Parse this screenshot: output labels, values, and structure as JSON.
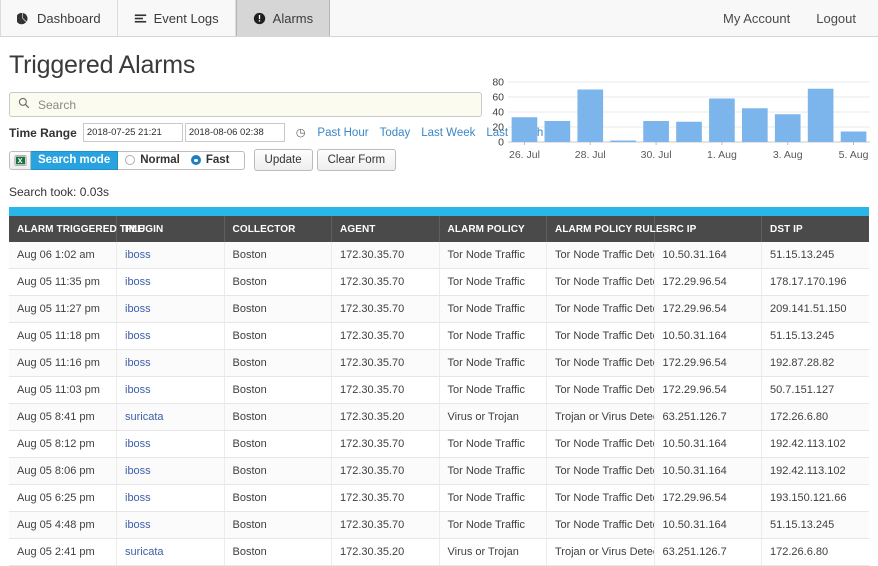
{
  "nav": {
    "tabs": [
      {
        "label": "Dashboard",
        "icon": "pie-chart-icon",
        "active": false
      },
      {
        "label": "Event Logs",
        "icon": "list-icon",
        "active": false
      },
      {
        "label": "Alarms",
        "icon": "alert-icon",
        "active": true
      }
    ],
    "account_label": "My Account",
    "logout_label": "Logout"
  },
  "page": {
    "title": "Triggered Alarms",
    "search_took": "Search took: 0.03s"
  },
  "search": {
    "placeholder": "Search",
    "value": "",
    "icon": "search-icon"
  },
  "time_range": {
    "label": "Time Range",
    "start": "2018-07-25 21:21",
    "end": "2018-08-06 02:38",
    "clock_icon": "clock-icon",
    "quick": [
      "Past Hour",
      "Today",
      "Last Week",
      "Last Month"
    ]
  },
  "controls": {
    "export_icon": "excel-export-icon",
    "search_mode_label": "Search mode",
    "modes": [
      {
        "label": "Normal",
        "selected": false
      },
      {
        "label": "Fast",
        "selected": true
      }
    ],
    "update_label": "Update",
    "clear_label": "Clear Form"
  },
  "colors": {
    "accent": "#29b6e8",
    "bar": "#7cb5ec",
    "link": "#3c5fa8",
    "quick_link": "#3a87c8",
    "header_bg": "#4a4a4a",
    "search_mode_bg": "#29a3e0"
  },
  "chart_data": {
    "type": "bar",
    "title": "",
    "xlabel": "",
    "ylabel": "",
    "ylim": [
      0,
      80
    ],
    "yticks": [
      0,
      20,
      40,
      60,
      80
    ],
    "grid": true,
    "legend": false,
    "categories": [
      "26. Jul",
      "27. Jul",
      "28. Jul",
      "29. Jul",
      "30. Jul",
      "31. Jul",
      "1. Aug",
      "2. Aug",
      "3. Aug",
      "4. Aug",
      "5. Aug"
    ],
    "tick_labels": [
      "26. Jul",
      "28. Jul",
      "30. Jul",
      "1. Aug",
      "3. Aug",
      "5. Aug"
    ],
    "tick_indices": [
      0,
      2,
      4,
      6,
      8,
      10
    ],
    "values": [
      33,
      28,
      70,
      2,
      28,
      27,
      58,
      45,
      37,
      71,
      14
    ]
  },
  "table": {
    "columns": [
      "ALARM TRIGGERED TIME",
      "PLUGIN",
      "COLLECTOR",
      "AGENT",
      "ALARM POLICY",
      "ALARM POLICY RULE",
      "SRC IP",
      "DST IP"
    ],
    "rows": [
      [
        "Aug 06 1:02 am",
        "iboss",
        "Boston",
        "172.30.35.70",
        "Tor Node Traffic",
        "Tor Node Traffic Detected",
        "10.50.31.164",
        "51.15.13.245"
      ],
      [
        "Aug 05 11:35 pm",
        "iboss",
        "Boston",
        "172.30.35.70",
        "Tor Node Traffic",
        "Tor Node Traffic Detected",
        "172.29.96.54",
        "178.17.170.196"
      ],
      [
        "Aug 05 11:27 pm",
        "iboss",
        "Boston",
        "172.30.35.70",
        "Tor Node Traffic",
        "Tor Node Traffic Detected",
        "172.29.96.54",
        "209.141.51.150"
      ],
      [
        "Aug 05 11:18 pm",
        "iboss",
        "Boston",
        "172.30.35.70",
        "Tor Node Traffic",
        "Tor Node Traffic Detected",
        "10.50.31.164",
        "51.15.13.245"
      ],
      [
        "Aug 05 11:16 pm",
        "iboss",
        "Boston",
        "172.30.35.70",
        "Tor Node Traffic",
        "Tor Node Traffic Detected",
        "172.29.96.54",
        "192.87.28.82"
      ],
      [
        "Aug 05 11:03 pm",
        "iboss",
        "Boston",
        "172.30.35.70",
        "Tor Node Traffic",
        "Tor Node Traffic Detected",
        "172.29.96.54",
        "50.7.151.127"
      ],
      [
        "Aug 05 8:41 pm",
        "suricata",
        "Boston",
        "172.30.35.20",
        "Virus or Trojan",
        "Trojan or Virus Detected",
        "63.251.126.7",
        "172.26.6.80"
      ],
      [
        "Aug 05 8:12 pm",
        "iboss",
        "Boston",
        "172.30.35.70",
        "Tor Node Traffic",
        "Tor Node Traffic Detected",
        "10.50.31.164",
        "192.42.113.102"
      ],
      [
        "Aug 05 8:06 pm",
        "iboss",
        "Boston",
        "172.30.35.70",
        "Tor Node Traffic",
        "Tor Node Traffic Detected",
        "10.50.31.164",
        "192.42.113.102"
      ],
      [
        "Aug 05 6:25 pm",
        "iboss",
        "Boston",
        "172.30.35.70",
        "Tor Node Traffic",
        "Tor Node Traffic Detected",
        "172.29.96.54",
        "193.150.121.66"
      ],
      [
        "Aug 05 4:48 pm",
        "iboss",
        "Boston",
        "172.30.35.70",
        "Tor Node Traffic",
        "Tor Node Traffic Detected",
        "10.50.31.164",
        "51.15.13.245"
      ],
      [
        "Aug 05 2:41 pm",
        "suricata",
        "Boston",
        "172.30.35.20",
        "Virus or Trojan",
        "Trojan or Virus Detected",
        "63.251.126.7",
        "172.26.6.80"
      ]
    ]
  }
}
